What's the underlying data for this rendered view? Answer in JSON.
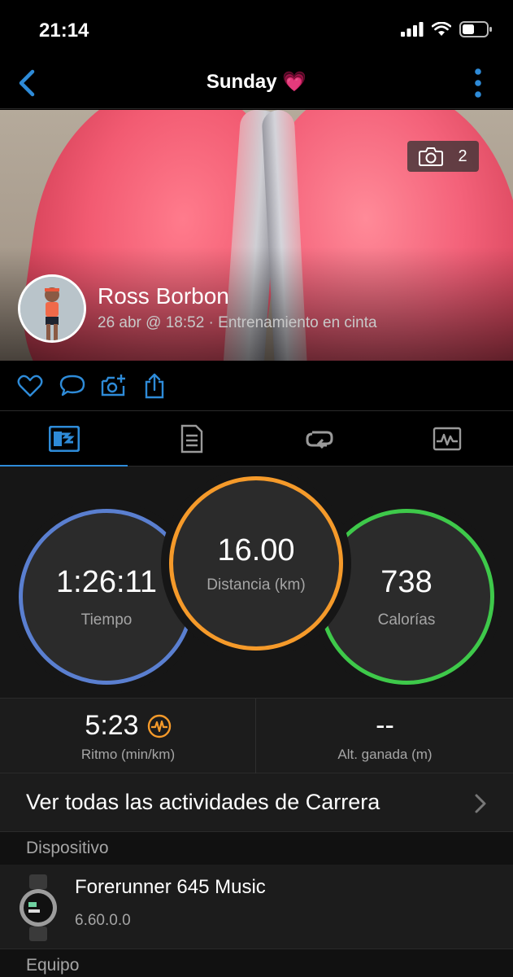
{
  "status": {
    "time": "21:14"
  },
  "nav": {
    "title": "Sunday 💗"
  },
  "hero": {
    "photo_count": "2"
  },
  "user": {
    "name": "Ross Borbon",
    "meta": "26 abr @ 18:52 · Entrenamiento en cinta"
  },
  "stats": {
    "time": {
      "value": "1:26:11",
      "label": "Tiempo"
    },
    "distance": {
      "value": "16.00",
      "label": "Distancia (km)"
    },
    "calories": {
      "value": "738",
      "label": "Calorías"
    }
  },
  "metrics": {
    "pace": {
      "value": "5:23",
      "label": "Ritmo (min/km)"
    },
    "elevation": {
      "value": "--",
      "label": "Alt. ganada (m)"
    }
  },
  "link": {
    "label": "Ver todas las actividades de Carrera"
  },
  "sections": {
    "device": "Dispositivo",
    "equipment": "Equipo"
  },
  "device": {
    "name": "Forerunner 645 Music",
    "version": "6.60.0.0"
  },
  "colors": {
    "accent": "#2e8bd8",
    "time_ring": "#5a7fd0",
    "distance_ring": "#f59a2a",
    "calories_ring": "#3ec94a",
    "pace_icon": "#f59a2a"
  }
}
